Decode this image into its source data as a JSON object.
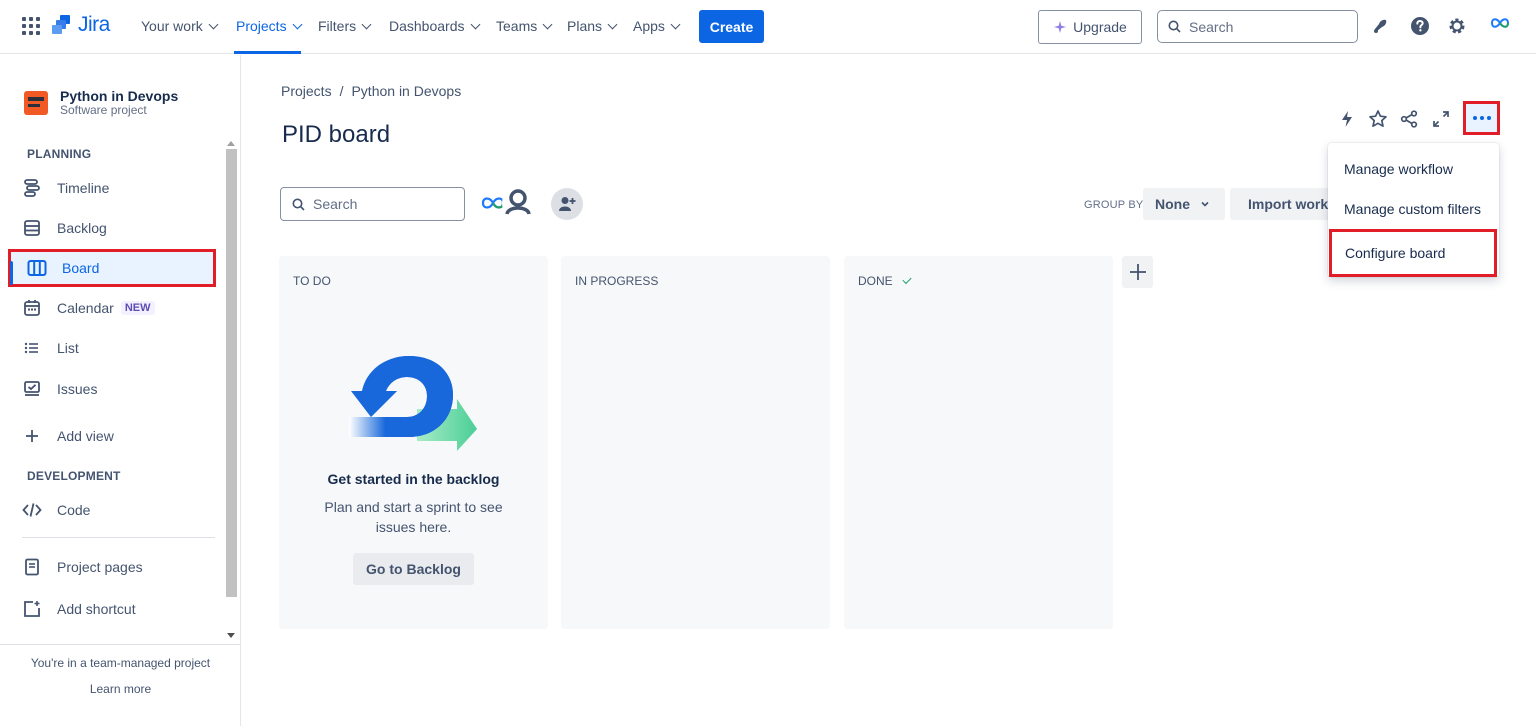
{
  "topnav": {
    "logo_text": "Jira",
    "items": [
      {
        "label": "Your work"
      },
      {
        "label": "Projects"
      },
      {
        "label": "Filters"
      },
      {
        "label": "Dashboards"
      },
      {
        "label": "Teams"
      },
      {
        "label": "Plans"
      },
      {
        "label": "Apps"
      }
    ],
    "active_item": "Projects",
    "create_label": "Create",
    "upgrade_label": "Upgrade",
    "search_placeholder": "Search",
    "accent_color": "#0c66e4"
  },
  "sidebar": {
    "project_name": "Python in Devops",
    "project_type": "Software project",
    "planning_title": "PLANNING",
    "planning_items": [
      {
        "label": "Timeline",
        "icon": "timeline-icon"
      },
      {
        "label": "Backlog",
        "icon": "backlog-icon"
      },
      {
        "label": "Board",
        "icon": "board-icon",
        "selected": true
      },
      {
        "label": "Calendar",
        "icon": "calendar-icon",
        "badge": "NEW"
      },
      {
        "label": "List",
        "icon": "list-icon"
      },
      {
        "label": "Issues",
        "icon": "issues-icon"
      }
    ],
    "add_view_label": "Add view",
    "development_title": "DEVELOPMENT",
    "code_label": "Code",
    "project_pages_label": "Project pages",
    "add_shortcut_label": "Add shortcut",
    "footer_note": "You're in a team-managed project",
    "footer_link": "Learn more"
  },
  "main": {
    "breadcrumb": {
      "root": "Projects",
      "separator": "/",
      "current": "Python in Devops"
    },
    "title": "PID board",
    "search_placeholder": "Search",
    "groupby_label": "GROUP BY",
    "groupby_value": "None",
    "import_label": "Import work",
    "columns": [
      {
        "title": "TO DO"
      },
      {
        "title": "IN PROGRESS"
      },
      {
        "title": "DONE"
      }
    ],
    "empty_state": {
      "title": "Get started in the backlog",
      "text": "Plan and start a sprint to see issues here.",
      "button": "Go to Backlog"
    }
  },
  "dropdown": {
    "items": [
      {
        "label": "Manage workflow"
      },
      {
        "label": "Manage custom filters"
      },
      {
        "label": "Configure board"
      }
    ]
  },
  "highlight_color": "#e11d28"
}
